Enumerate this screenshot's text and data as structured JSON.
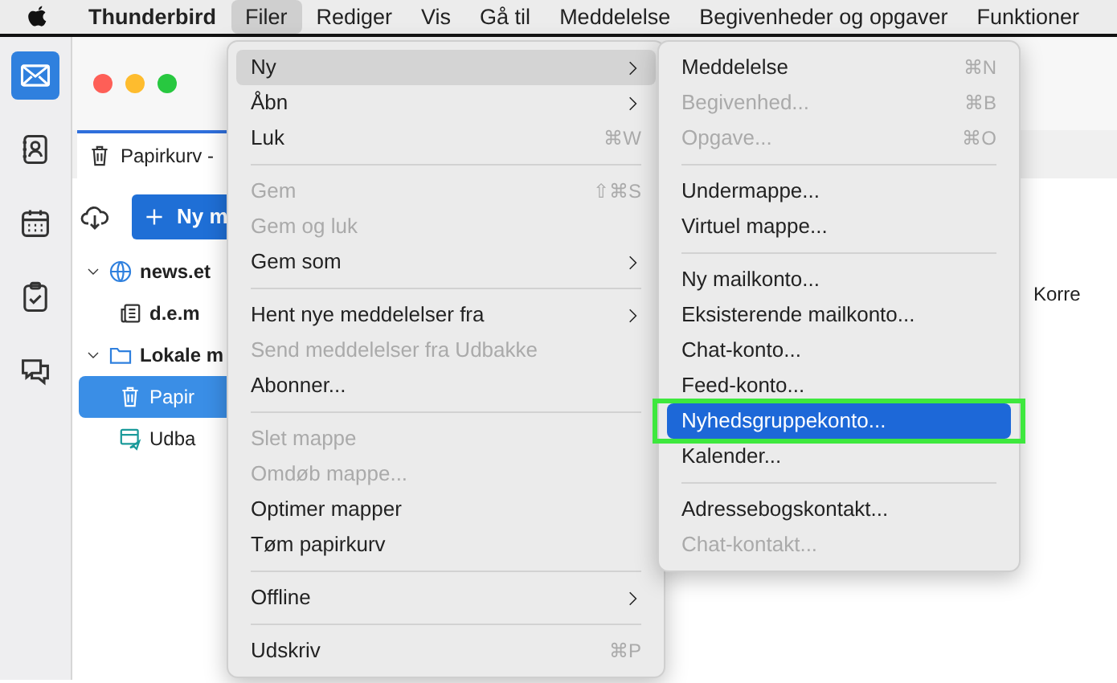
{
  "menubar": [
    {
      "label": "Thunderbird",
      "kind": "app",
      "selected": false
    },
    {
      "label": "Filer",
      "kind": "menu",
      "selected": true
    },
    {
      "label": "Rediger",
      "kind": "menu",
      "selected": false
    },
    {
      "label": "Vis",
      "kind": "menu",
      "selected": false
    },
    {
      "label": "Gå til",
      "kind": "menu",
      "selected": false
    },
    {
      "label": "Meddelelse",
      "kind": "menu",
      "selected": false
    },
    {
      "label": "Begivenheder og opgaver",
      "kind": "menu",
      "selected": false
    },
    {
      "label": "Funktioner",
      "kind": "menu",
      "selected": false
    }
  ],
  "spaces": [
    {
      "kind": "mail",
      "selected": true
    },
    {
      "kind": "addressbook",
      "selected": false
    },
    {
      "kind": "calendar",
      "selected": false
    },
    {
      "kind": "tasks",
      "selected": false
    },
    {
      "kind": "chat",
      "selected": false
    }
  ],
  "tab": {
    "label": "Papirkurv -"
  },
  "new_button": {
    "label": "Ny m"
  },
  "folders": [
    {
      "label": "news.et",
      "kind": "server",
      "expanded": true,
      "selected": false,
      "children": [
        {
          "label": "d.e.m",
          "kind": "newsgroup",
          "selected": false
        }
      ]
    },
    {
      "label": "Lokale m",
      "kind": "local",
      "expanded": true,
      "selected": false,
      "children": [
        {
          "label": "Papir",
          "kind": "trash",
          "selected": true
        },
        {
          "label": "Udba",
          "kind": "outbox",
          "selected": false
        }
      ]
    }
  ],
  "message_list": {
    "column_2": "Korre"
  },
  "file_menu": [
    {
      "kind": "item",
      "label": "Ny",
      "submenu": true,
      "selected": true,
      "disabled": false
    },
    {
      "kind": "item",
      "label": "Åbn",
      "submenu": true,
      "selected": false,
      "disabled": false
    },
    {
      "kind": "item",
      "label": "Luk",
      "shortcut": "⌘W",
      "selected": false,
      "disabled": false
    },
    {
      "kind": "separator"
    },
    {
      "kind": "item",
      "label": "Gem",
      "shortcut": "⇧⌘S",
      "selected": false,
      "disabled": true
    },
    {
      "kind": "item",
      "label": "Gem og luk",
      "selected": false,
      "disabled": true
    },
    {
      "kind": "item",
      "label": "Gem som",
      "submenu": true,
      "selected": false,
      "disabled": false
    },
    {
      "kind": "separator"
    },
    {
      "kind": "item",
      "label": "Hent nye meddelelser fra",
      "submenu": true,
      "selected": false,
      "disabled": false
    },
    {
      "kind": "item",
      "label": "Send meddelelser fra Udbakke",
      "selected": false,
      "disabled": true
    },
    {
      "kind": "item",
      "label": "Abonner...",
      "selected": false,
      "disabled": false
    },
    {
      "kind": "separator"
    },
    {
      "kind": "item",
      "label": "Slet mappe",
      "selected": false,
      "disabled": true
    },
    {
      "kind": "item",
      "label": "Omdøb mappe...",
      "selected": false,
      "disabled": true
    },
    {
      "kind": "item",
      "label": "Optimer mapper",
      "selected": false,
      "disabled": false
    },
    {
      "kind": "item",
      "label": "Tøm papirkurv",
      "selected": false,
      "disabled": false
    },
    {
      "kind": "separator"
    },
    {
      "kind": "item",
      "label": "Offline",
      "submenu": true,
      "selected": false,
      "disabled": false
    },
    {
      "kind": "separator"
    },
    {
      "kind": "item",
      "label": "Udskriv",
      "shortcut": "⌘P",
      "selected": false,
      "disabled": false
    }
  ],
  "new_submenu": [
    {
      "kind": "item",
      "label": "Meddelelse",
      "shortcut": "⌘N",
      "selected": false,
      "disabled": false
    },
    {
      "kind": "item",
      "label": "Begivenhed...",
      "shortcut": "⌘B",
      "selected": false,
      "disabled": true
    },
    {
      "kind": "item",
      "label": "Opgave...",
      "shortcut": "⌘O",
      "selected": false,
      "disabled": true
    },
    {
      "kind": "separator"
    },
    {
      "kind": "item",
      "label": "Undermappe...",
      "selected": false,
      "disabled": false
    },
    {
      "kind": "item",
      "label": "Virtuel mappe...",
      "selected": false,
      "disabled": false
    },
    {
      "kind": "separator"
    },
    {
      "kind": "item",
      "label": "Ny mailkonto...",
      "selected": false,
      "disabled": false
    },
    {
      "kind": "item",
      "label": "Eksisterende mailkonto...",
      "selected": false,
      "disabled": false
    },
    {
      "kind": "item",
      "label": "Chat-konto...",
      "selected": false,
      "disabled": false
    },
    {
      "kind": "item",
      "label": "Feed-konto...",
      "selected": false,
      "disabled": false
    },
    {
      "kind": "item",
      "label": "Nyhedsgruppekonto...",
      "selected": true,
      "disabled": false,
      "annotated": true
    },
    {
      "kind": "item",
      "label": "Kalender...",
      "selected": false,
      "disabled": false
    },
    {
      "kind": "separator"
    },
    {
      "kind": "item",
      "label": "Adressebogskontakt...",
      "selected": false,
      "disabled": false
    },
    {
      "kind": "item",
      "label": "Chat-kontakt...",
      "selected": false,
      "disabled": true
    }
  ]
}
